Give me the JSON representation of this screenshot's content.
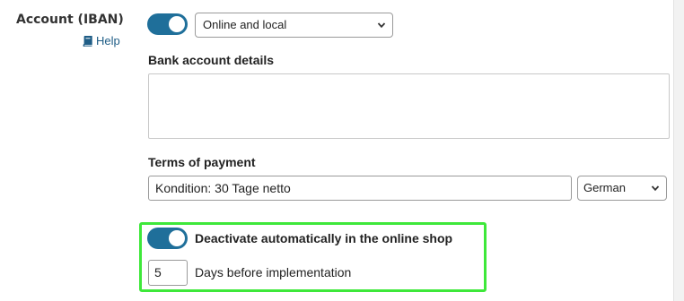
{
  "field": {
    "label": "Account (IBAN)",
    "help_label": "Help",
    "help_icon": "book-icon"
  },
  "availability": {
    "toggle_on": true,
    "selected": "Online and local"
  },
  "bank_details": {
    "label": "Bank account details",
    "value": ""
  },
  "terms": {
    "label": "Terms of payment",
    "value": "Kondition: 30 Tage netto",
    "language": "German"
  },
  "deactivate": {
    "toggle_on": true,
    "label": "Deactivate automatically in the online shop",
    "days_value": "5",
    "days_label": "Days before implementation"
  },
  "colors": {
    "toggle_on": "#1f6f9a",
    "link": "#1f5d86",
    "highlight": "#3ee83a"
  }
}
